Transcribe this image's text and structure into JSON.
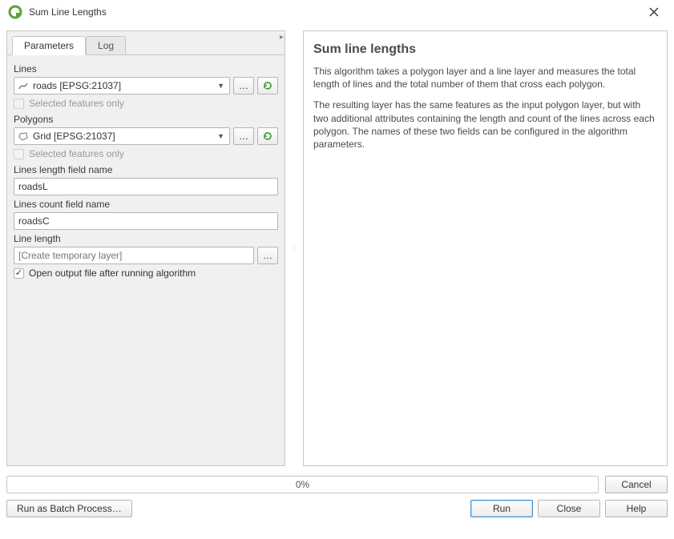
{
  "window": {
    "title": "Sum Line Lengths"
  },
  "tabs": {
    "parameters": "Parameters",
    "log": "Log"
  },
  "form": {
    "lines_label": "Lines",
    "lines_value": "roads [EPSG:21037]",
    "lines_selected_only": "Selected features only",
    "polygons_label": "Polygons",
    "polygons_value": "Grid [EPSG:21037]",
    "polygons_selected_only": "Selected features only",
    "length_field_label": "Lines length field name",
    "length_field_value": "roadsL",
    "count_field_label": "Lines count field name",
    "count_field_value": "roadsC",
    "output_label": "Line length",
    "output_placeholder": "[Create temporary layer]",
    "open_after": "Open output file after running algorithm",
    "browse_btn": "…"
  },
  "help": {
    "title": "Sum line lengths",
    "p1": "This algorithm takes a polygon layer and a line layer and measures the total length of lines and the total number of them that cross each polygon.",
    "p2": "The resulting layer has the same features as the input polygon layer, but with two additional attributes containing the length and count of the lines across each polygon. The names of these two fields can be configured in the algorithm parameters."
  },
  "footer": {
    "progress_text": "0%",
    "cancel": "Cancel",
    "batch": "Run as Batch Process…",
    "run": "Run",
    "close": "Close",
    "help": "Help"
  }
}
